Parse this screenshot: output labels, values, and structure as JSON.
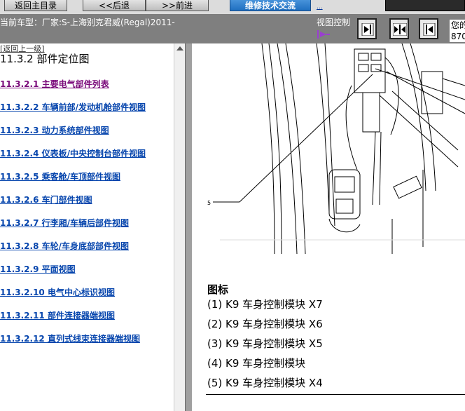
{
  "toolbar": {
    "buttons": [
      "返回主目录",
      "<<后退",
      ">>前进",
      "维修技术交流",
      ""
    ],
    "small_link": "..."
  },
  "infobar": {
    "car_label": "当前车型：厂家:S-上海别克君威(Regal)2011-",
    "view_control_label": "视图控制",
    "side_text_1": "您的",
    "side_text_2": "870"
  },
  "nav": {
    "back_link": "[返回上一级]",
    "section_title": "11.3.2 部件定位图",
    "items": [
      "11.3.2.1 主要电气部件列表",
      "11.3.2.2 车辆前部/发动机舱部件视图",
      "11.3.2.3 动力系统部件视图",
      "11.3.2.4 仪表板/中央控制台部件视图",
      "11.3.2.5 乘客舱/车顶部件视图",
      "11.3.2.6 车门部件视图",
      "11.3.2.7 行李厢/车辆后部件视图",
      "11.3.2.8 车轮/车身底部部件视图",
      "11.3.2.9 平面视图",
      "11.3.2.10 电气中心标识视图",
      "11.3.2.11 部件连接器端视图",
      "11.3.2.12 直列式线束连接器端视图"
    ]
  },
  "diagram": {
    "callout": "5"
  },
  "legend": {
    "title": "图标",
    "items": [
      "(1) K9 车身控制模块  X7",
      "(2) K9 车身控制模块  X6",
      "(3) K9 车身控制模块  X5",
      "(4) K9 车身控制模块",
      "(5) K9 车身控制模块  X4"
    ]
  },
  "colors": {
    "toolbar_bg": "#dcdcdc",
    "infobar_bg": "#7f7f7f",
    "link": "#0645ad",
    "visited_link": "#7a0a7a",
    "accent_button": "#1f6fc0"
  }
}
